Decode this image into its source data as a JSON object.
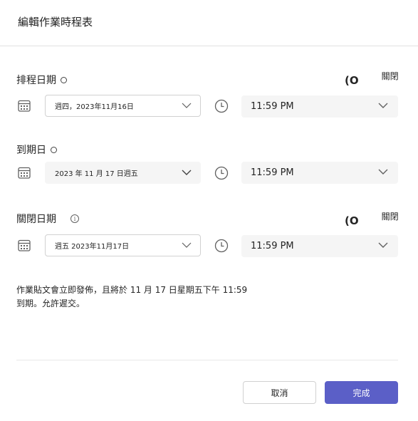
{
  "dialog": {
    "title": "編輯作業時程表"
  },
  "schedule_date": {
    "label": "排程日期",
    "toggle_glyph": "(O",
    "toggle_label": "關閉",
    "date_value": "週四，2023年11月16日",
    "time_value": "11:59 PM"
  },
  "due_date": {
    "label": "到期日",
    "date_value": "2023 年  11 月  17 日週五",
    "time_value": "11:59 PM"
  },
  "close_date": {
    "label": "關閉日期",
    "info_glyph": "i",
    "toggle_glyph": "(O",
    "toggle_label": "關閉",
    "date_value": "週五 2023年11月17日",
    "time_value": "11:59 PM"
  },
  "summary": {
    "line1": "作業貼文會立即發佈，且將於 11 月 17 日星期五下午 11:59",
    "line2": "到期。允許遲交。"
  },
  "buttons": {
    "cancel": "取消",
    "done": "完成"
  },
  "colors": {
    "primary": "#5b5fc7",
    "field_fill": "#f5f5f5",
    "border": "#d1d1d1",
    "text": "#242424"
  },
  "icons": {
    "calendar": "calendar-icon",
    "clock": "clock-icon",
    "chevron": "chevron-down-icon",
    "info": "info-icon"
  }
}
